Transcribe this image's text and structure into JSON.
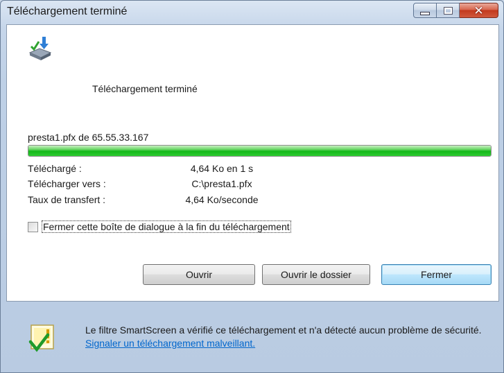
{
  "window": {
    "title": "Téléchargement terminé",
    "minimize": "",
    "maximize": ""
  },
  "header": {
    "title": "Téléchargement terminé",
    "icon": "download-complete-icon"
  },
  "download": {
    "source": "presta1.pfx de 65.55.33.167",
    "progress_percent": 100,
    "rows": [
      {
        "label": "Téléchargé :",
        "value": "4,64 Ko en 1 s"
      },
      {
        "label": "Télécharger vers :",
        "value": "C:\\presta1.pfx"
      },
      {
        "label": "Taux de transfert :",
        "value": "4,64 Ko/seconde"
      }
    ]
  },
  "options": {
    "close_on_finish_label": "Fermer cette boîte de dialogue à la fin du téléchargement",
    "close_on_finish_checked": false
  },
  "buttons": {
    "open": "Ouvrir",
    "open_folder": "Ouvrir le dossier",
    "close": "Fermer"
  },
  "footer": {
    "message": "Le filtre SmartScreen a vérifié ce téléchargement et n'a détecté aucun problème de sécurité.",
    "link": "Signaler un téléchargement malveillant."
  },
  "colors": {
    "progress": "#14b81a",
    "link": "#0066cc",
    "close_caption": "#c2391d"
  }
}
